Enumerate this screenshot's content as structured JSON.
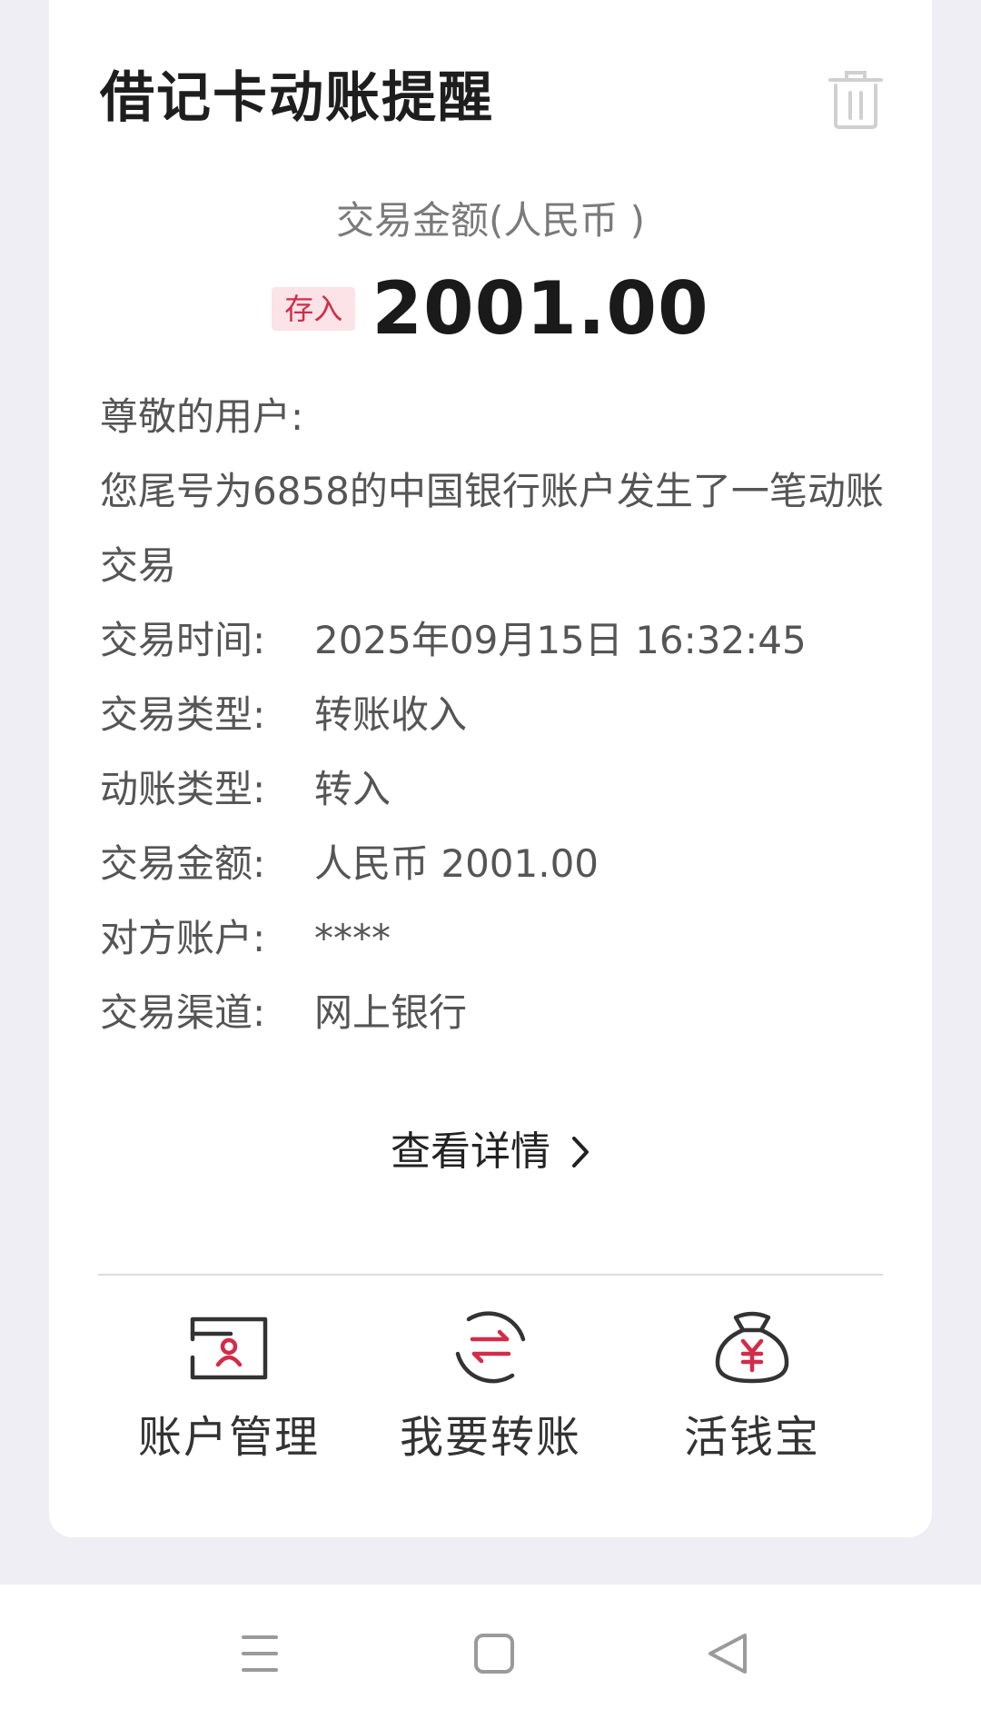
{
  "card": {
    "title": "借记卡动账提醒",
    "delete_icon": "trash-icon"
  },
  "amount": {
    "label": "交易金额(人民币 )",
    "badge": "存入",
    "value": "2001.00"
  },
  "message": {
    "greeting": "尊敬的用户:",
    "body": "您尾号为6858的中国银行账户发生了一笔动账交易",
    "fields": [
      {
        "label": "交易时间:",
        "value": "2025年09月15日 16:32:45"
      },
      {
        "label": "交易类型:",
        "value": "转账收入"
      },
      {
        "label": "动账类型:",
        "value": "转入"
      },
      {
        "label": "交易金额:",
        "value": "人民币 2001.00"
      },
      {
        "label": "对方账户:",
        "value": "****"
      },
      {
        "label": "交易渠道:",
        "value": "网上银行"
      }
    ]
  },
  "detail_link": {
    "label": "查看详情",
    "icon": "chevron-right-icon"
  },
  "actions": [
    {
      "label": "账户管理",
      "icon": "account-card-icon"
    },
    {
      "label": "我要转账",
      "icon": "transfer-icon"
    },
    {
      "label": "活钱宝",
      "icon": "money-bag-icon"
    }
  ],
  "colors": {
    "accent": "#d22c48",
    "badge_bg": "#fbe3e7",
    "background": "#efeef4"
  },
  "navbar": {
    "icons": [
      "menu-icon",
      "home-icon",
      "back-icon"
    ]
  }
}
